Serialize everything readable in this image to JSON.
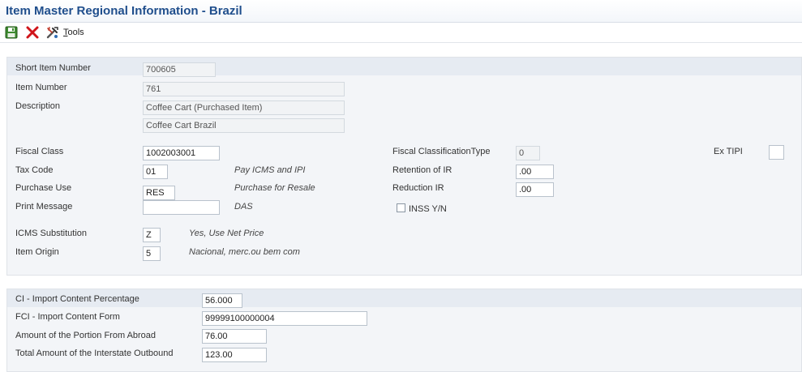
{
  "window": {
    "title": "Item Master Regional Information - Brazil"
  },
  "toolbar": {
    "save_icon": "floppy-disk-icon",
    "cancel_icon": "red-x-icon",
    "tools_icon": "tools-icon",
    "tools_label": "Tools",
    "tools_hotkey": "T",
    "tools_rest": "ools"
  },
  "header_fields": {
    "short_item_number": {
      "label": "Short Item Number",
      "value": "700605"
    },
    "item_number": {
      "label": "Item Number",
      "value": "761"
    },
    "description": {
      "label": "Description",
      "value1": "Coffee Cart (Purchased Item)",
      "value2": "Coffee Cart Brazil"
    }
  },
  "fiscal": {
    "fiscal_class": {
      "label": "Fiscal Class",
      "value": "1002003001"
    },
    "tax_code": {
      "label": "Tax Code",
      "value": "01",
      "desc": "Pay ICMS and IPI"
    },
    "purchase_use": {
      "label": "Purchase Use",
      "value": "RES",
      "desc": "Purchase for Resale"
    },
    "print_message": {
      "label": "Print Message",
      "value": "",
      "desc": "DAS"
    },
    "icms_substitution": {
      "label": "ICMS Substitution",
      "value": "Z",
      "desc": "Yes, Use Net Price"
    },
    "item_origin": {
      "label": "Item Origin",
      "value": "5",
      "desc": "Nacional, merc.ou bem com"
    },
    "fiscal_classification_type": {
      "label": "Fiscal ClassificationType",
      "value": "0"
    },
    "retention_of_ir": {
      "label": "Retention of IR",
      "value": ".00"
    },
    "reduction_ir": {
      "label": "Reduction IR",
      "value": ".00"
    },
    "inss": {
      "label": "INSS Y/N",
      "checked": false
    },
    "ex_tipi": {
      "label": "Ex TIPI",
      "value": ""
    }
  },
  "import_content": {
    "ci_percentage": {
      "label": "CI - Import Content Percentage",
      "value": "56.000"
    },
    "fci_form": {
      "label": "FCI - Import Content Form",
      "value": "99999100000004"
    },
    "portion_from_abroad": {
      "label": "Amount of the Portion From Abroad",
      "value": "76.00"
    },
    "interstate_outbound": {
      "label": "Total Amount of the Interstate Outbound",
      "value": "123.00"
    }
  },
  "colors": {
    "title": "#1f4e8c",
    "panel_bg": "#f3f5f8",
    "panel_band": "#e6ebf2",
    "cancel_red": "#d0141a",
    "save_green": "#3d8a2f"
  }
}
